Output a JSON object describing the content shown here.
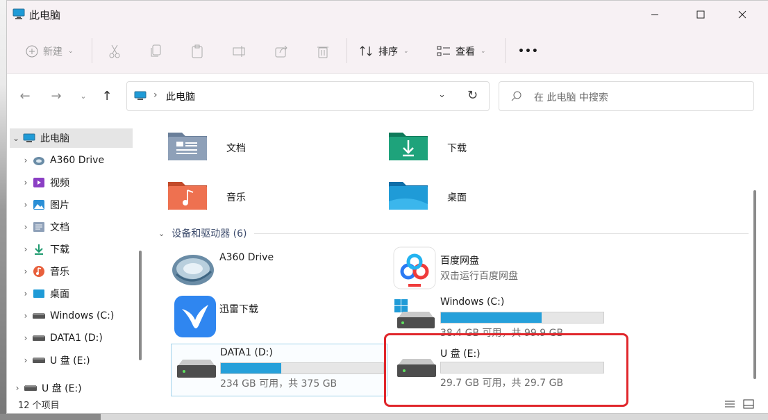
{
  "window": {
    "title": "此电脑"
  },
  "toolbar": {
    "new_label": "新建",
    "sort_label": "排序",
    "view_label": "查看",
    "more_label": "•••"
  },
  "address": {
    "path": "此电脑",
    "search_placeholder": "在 此电脑 中搜索"
  },
  "sidebar": {
    "items": [
      {
        "label": "此电脑",
        "icon": "computer-icon",
        "expanded": true
      },
      {
        "label": "A360 Drive",
        "icon": "a360-icon"
      },
      {
        "label": "视频",
        "icon": "video-folder-icon"
      },
      {
        "label": "图片",
        "icon": "pictures-folder-icon"
      },
      {
        "label": "文档",
        "icon": "documents-folder-icon"
      },
      {
        "label": "下载",
        "icon": "download-icon"
      },
      {
        "label": "音乐",
        "icon": "music-icon"
      },
      {
        "label": "桌面",
        "icon": "desktop-folder-icon"
      },
      {
        "label": "Windows (C:)",
        "icon": "drive-icon"
      },
      {
        "label": "DATA1 (D:)",
        "icon": "drive-icon"
      },
      {
        "label": "U 盘 (E:)",
        "icon": "drive-icon"
      },
      {
        "label": "U 盘 (E:)",
        "icon": "drive-icon"
      }
    ]
  },
  "folders": [
    {
      "label": "文档",
      "icon": "documents-folder-icon"
    },
    {
      "label": "下载",
      "icon": "downloads-folder-icon"
    },
    {
      "label": "音乐",
      "icon": "music-folder-icon"
    },
    {
      "label": "桌面",
      "icon": "desktop-folder-icon"
    }
  ],
  "devices": {
    "header": "设备和驱动器 (6)",
    "items": [
      {
        "name": "A360 Drive",
        "icon": "a360-icon"
      },
      {
        "name": "百度网盘",
        "sub": "双击运行百度网盘",
        "icon": "baidu-netdisk-icon"
      },
      {
        "name": "迅雷下载",
        "icon": "xunlei-icon"
      },
      {
        "name": "Windows (C:)",
        "sub": "38.4 GB 可用，共 99.9 GB",
        "used_fraction": 0.62,
        "icon": "windows-drive-icon"
      },
      {
        "name": "DATA1 (D:)",
        "sub": "234 GB 可用，共 375 GB",
        "used_fraction": 0.37,
        "icon": "drive-icon"
      },
      {
        "name": "U 盘 (E:)",
        "sub": "29.7 GB 可用，共 29.7 GB",
        "used_fraction": 0.0,
        "icon": "drive-icon"
      }
    ]
  },
  "status": {
    "count": "12 个项目"
  },
  "colors": {
    "accent": "#26a0da",
    "highlight": "#e0262b"
  }
}
